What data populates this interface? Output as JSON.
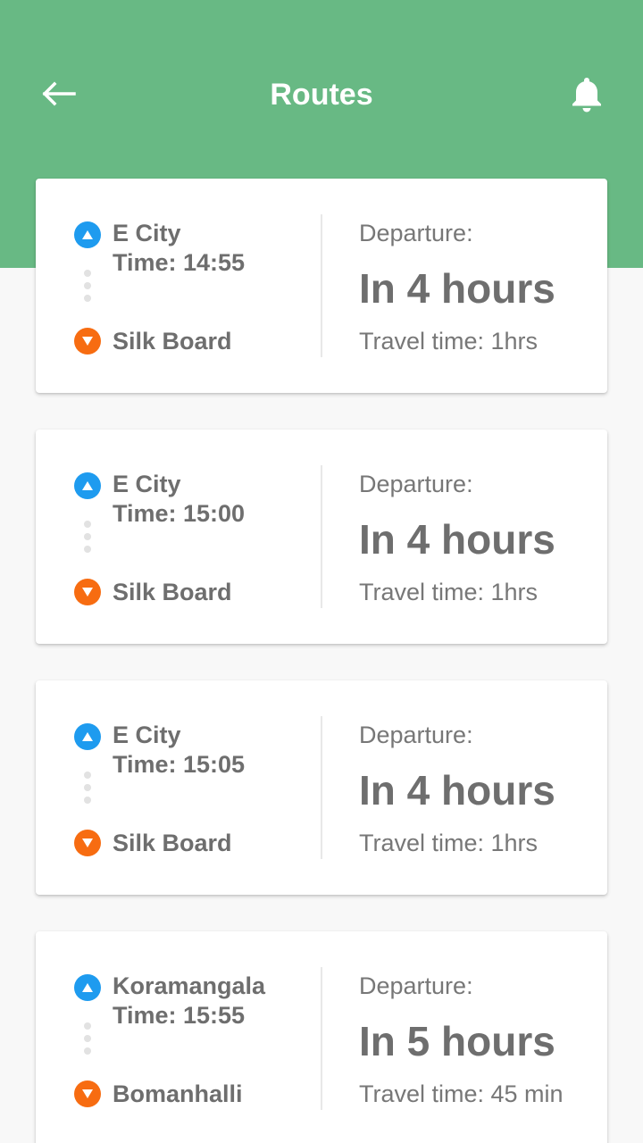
{
  "header": {
    "title": "Routes",
    "back_icon": "arrow-left-icon",
    "notification_icon": "bell-icon"
  },
  "colors": {
    "header_bg": "#68b984",
    "origin_marker": "#1e9bef",
    "destination_marker": "#f76c11"
  },
  "routes": [
    {
      "origin": "E City",
      "time": "Time: 14:55",
      "destination": "Silk Board",
      "departure_label": "Departure:",
      "departure_value": "In 4 hours",
      "travel_time": "Travel time: 1hrs"
    },
    {
      "origin": "E City",
      "time": "Time: 15:00",
      "destination": "Silk Board",
      "departure_label": "Departure:",
      "departure_value": "In 4 hours",
      "travel_time": "Travel time: 1hrs"
    },
    {
      "origin": "E City",
      "time": "Time: 15:05",
      "destination": "Silk Board",
      "departure_label": "Departure:",
      "departure_value": "In 4 hours",
      "travel_time": "Travel time: 1hrs"
    },
    {
      "origin": "Koramangala",
      "time": "Time: 15:55",
      "destination": "Bomanhalli",
      "departure_label": "Departure:",
      "departure_value": "In 5 hours",
      "travel_time": "Travel time: 45 min"
    }
  ]
}
